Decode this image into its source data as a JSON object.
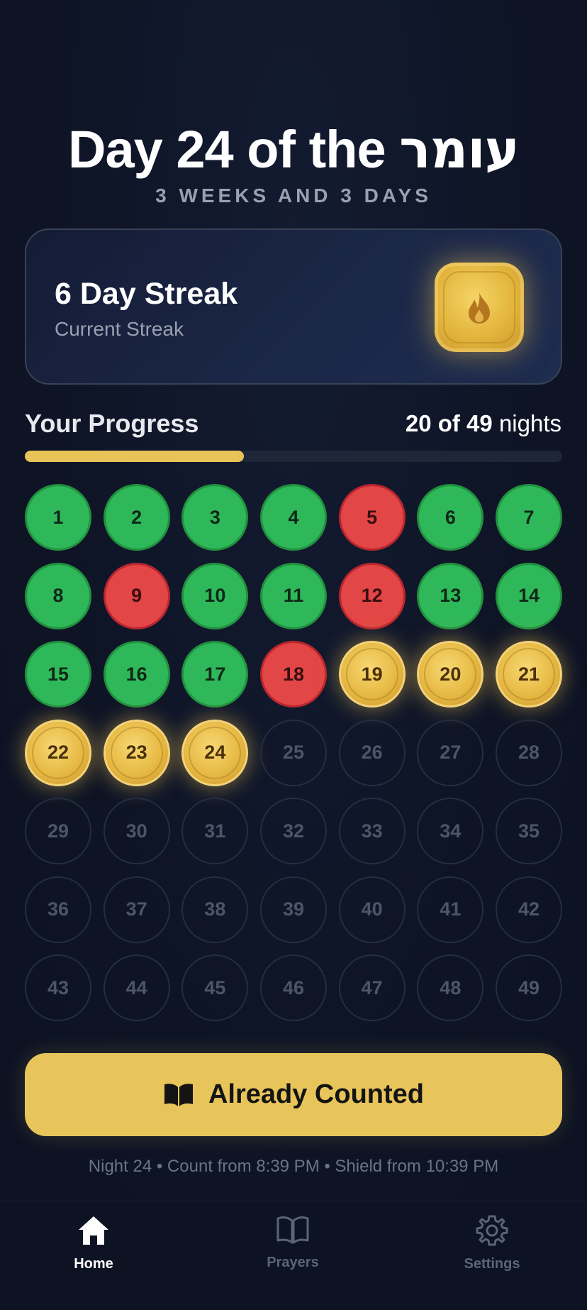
{
  "header": {
    "title_prefix": "Day 24 of the ",
    "title_hebrew": "עומר",
    "subtitle": "3 WEEKS AND 3 DAYS"
  },
  "streak": {
    "title": "6 Day Streak",
    "subtitle": "Current Streak",
    "icon": "flame-icon"
  },
  "progress": {
    "label": "Your Progress",
    "count": "20 of 49",
    "unit": "nights",
    "fraction": 0.408
  },
  "days": [
    {
      "n": "1",
      "status": "counted"
    },
    {
      "n": "2",
      "status": "counted"
    },
    {
      "n": "3",
      "status": "counted"
    },
    {
      "n": "4",
      "status": "counted"
    },
    {
      "n": "5",
      "status": "missed"
    },
    {
      "n": "6",
      "status": "counted"
    },
    {
      "n": "7",
      "status": "counted"
    },
    {
      "n": "8",
      "status": "counted"
    },
    {
      "n": "9",
      "status": "missed"
    },
    {
      "n": "10",
      "status": "counted"
    },
    {
      "n": "11",
      "status": "counted"
    },
    {
      "n": "12",
      "status": "missed"
    },
    {
      "n": "13",
      "status": "counted"
    },
    {
      "n": "14",
      "status": "counted"
    },
    {
      "n": "15",
      "status": "counted"
    },
    {
      "n": "16",
      "status": "counted"
    },
    {
      "n": "17",
      "status": "counted"
    },
    {
      "n": "18",
      "status": "missed"
    },
    {
      "n": "19",
      "status": "gold"
    },
    {
      "n": "20",
      "status": "gold"
    },
    {
      "n": "21",
      "status": "gold"
    },
    {
      "n": "22",
      "status": "gold"
    },
    {
      "n": "23",
      "status": "gold"
    },
    {
      "n": "24",
      "status": "gold"
    },
    {
      "n": "25",
      "status": "future"
    },
    {
      "n": "26",
      "status": "future"
    },
    {
      "n": "27",
      "status": "future"
    },
    {
      "n": "28",
      "status": "future"
    },
    {
      "n": "29",
      "status": "future"
    },
    {
      "n": "30",
      "status": "future"
    },
    {
      "n": "31",
      "status": "future"
    },
    {
      "n": "32",
      "status": "future"
    },
    {
      "n": "33",
      "status": "future"
    },
    {
      "n": "34",
      "status": "future"
    },
    {
      "n": "35",
      "status": "future"
    },
    {
      "n": "36",
      "status": "future"
    },
    {
      "n": "37",
      "status": "future"
    },
    {
      "n": "38",
      "status": "future"
    },
    {
      "n": "39",
      "status": "future"
    },
    {
      "n": "40",
      "status": "future"
    },
    {
      "n": "41",
      "status": "future"
    },
    {
      "n": "42",
      "status": "future"
    },
    {
      "n": "43",
      "status": "future"
    },
    {
      "n": "44",
      "status": "future"
    },
    {
      "n": "45",
      "status": "future"
    },
    {
      "n": "46",
      "status": "future"
    },
    {
      "n": "47",
      "status": "future"
    },
    {
      "n": "48",
      "status": "future"
    },
    {
      "n": "49",
      "status": "future"
    }
  ],
  "cta": {
    "label": "Already Counted",
    "icon": "open-book-icon"
  },
  "footnote": "Night 24 • Count from 8:39 PM • Shield from 10:39 PM",
  "tabs": [
    {
      "label": "Home",
      "icon": "home-icon",
      "active": true
    },
    {
      "label": "Prayers",
      "icon": "book-icon",
      "active": false
    },
    {
      "label": "Settings",
      "icon": "gear-icon",
      "active": false
    }
  ],
  "colors": {
    "background": "#0f1527",
    "accent_gold": "#e8c55a",
    "counted_green": "#2fb85a",
    "missed_red": "#e34646"
  }
}
